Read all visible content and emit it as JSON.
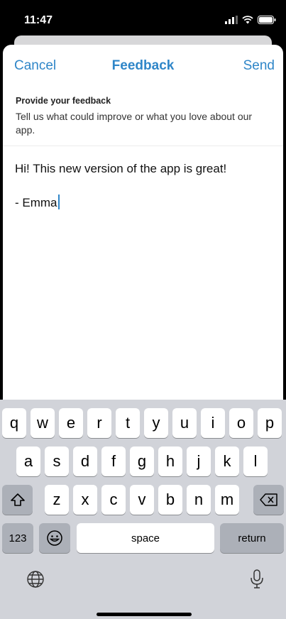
{
  "status_bar": {
    "time": "11:47"
  },
  "nav": {
    "cancel": "Cancel",
    "title": "Feedback",
    "send": "Send"
  },
  "prompt": {
    "title": "Provide your feedback",
    "text": "Tell us what could improve or what you love about our app."
  },
  "editor": {
    "line1": "Hi! This new version of the app is great!",
    "line2": "- Emma"
  },
  "keyboard": {
    "row1": [
      "q",
      "w",
      "e",
      "r",
      "t",
      "y",
      "u",
      "i",
      "o",
      "p"
    ],
    "row2": [
      "a",
      "s",
      "d",
      "f",
      "g",
      "h",
      "j",
      "k",
      "l"
    ],
    "row3": [
      "z",
      "x",
      "c",
      "v",
      "b",
      "n",
      "m"
    ],
    "numbers": "123",
    "space": "space",
    "return": "return",
    "icons": [
      "shift-icon",
      "backspace-icon",
      "emoji-icon",
      "globe-icon",
      "microphone-icon"
    ]
  },
  "colors": {
    "accent": "#2f86c8",
    "keyboard_bg": "#d1d3d9"
  }
}
